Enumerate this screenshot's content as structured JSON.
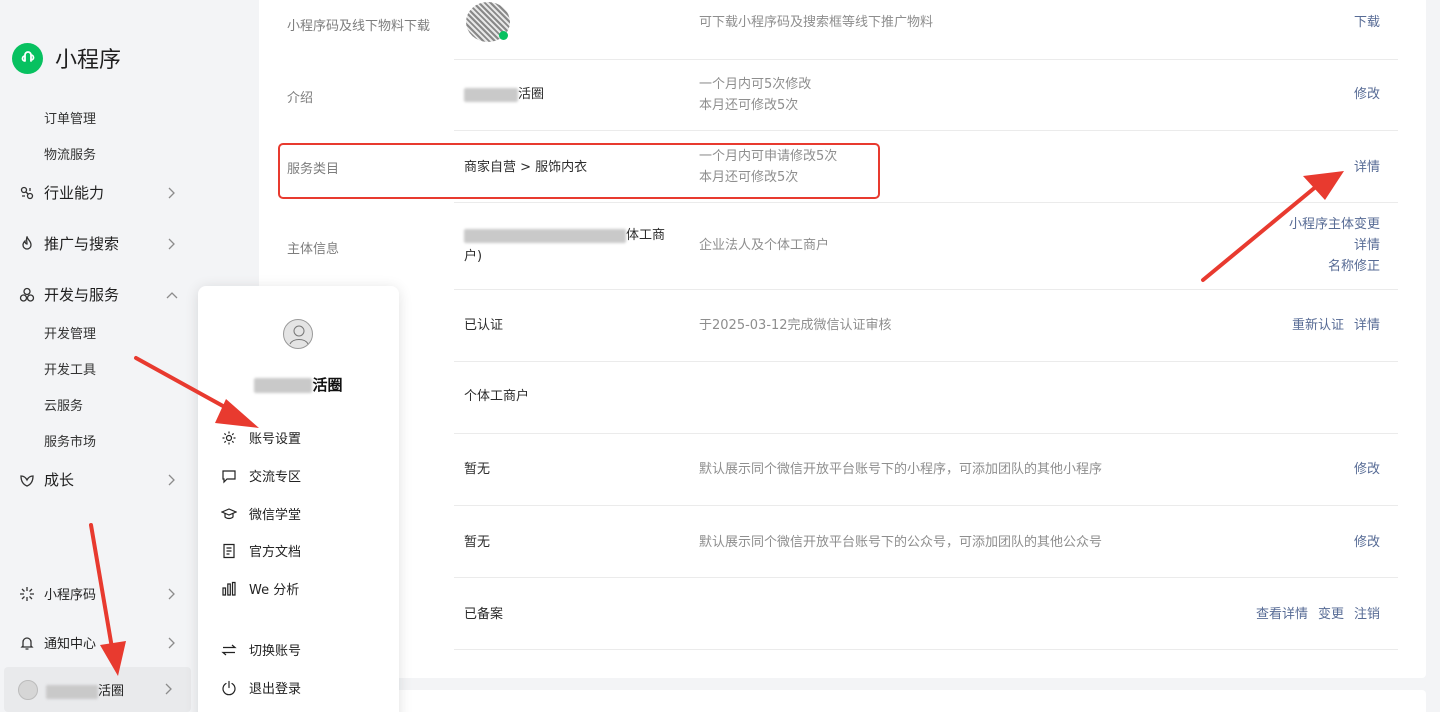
{
  "sidebar": {
    "title": "小程序",
    "items": {
      "order_mgmt": "订单管理",
      "logistics": "物流服务",
      "industry": "行业能力",
      "promo": "推广与搜索",
      "dev_service": "开发与服务",
      "dev_mgmt": "开发管理",
      "dev_tools": "开发工具",
      "cloud": "云服务",
      "market": "服务市场",
      "growth": "成长",
      "code": "小程序码",
      "notify": "通知中心"
    },
    "account_suffix": "活圈"
  },
  "rows": {
    "qrcode": {
      "label": "小程序码及线下物料下载",
      "desc": "可下载小程序码及搜索框等线下推广物料",
      "action": "下载"
    },
    "intro": {
      "label": "介绍",
      "value_suffix": "活圈",
      "desc1": "一个月内可5次修改",
      "desc2": "本月还可修改5次",
      "action": "修改"
    },
    "category": {
      "label": "服务类目",
      "value": "商家自营 > 服饰内衣",
      "desc1": "一个月内可申请修改5次",
      "desc2": "本月还可修改5次",
      "action": "详情"
    },
    "subject": {
      "label": "主体信息",
      "value_part": "体工商",
      "value_end": "户)",
      "desc": "企业法人及个体工商户",
      "action1": "小程序主体变更",
      "action2": "详情",
      "action3": "名称修正"
    },
    "certify": {
      "value": "已认证",
      "desc": "于2025-03-12完成微信认证审核",
      "action1": "重新认证",
      "action2": "详情"
    },
    "type": {
      "value": "个体工商户"
    },
    "related_mp": {
      "value": "暂无",
      "desc": "默认展示同个微信开放平台账号下的小程序，可添加团队的其他小程序",
      "action": "修改"
    },
    "related_oa": {
      "value": "暂无",
      "desc": "默认展示同个微信开放平台账号下的公众号，可添加团队的其他公众号",
      "action": "修改"
    },
    "filing": {
      "value": "已备案",
      "action1": "查看详情",
      "action2": "变更",
      "action3": "注销"
    }
  },
  "popup": {
    "name_suffix": "活圈",
    "items": {
      "account_settings": "账号设置",
      "community": "交流专区",
      "academy": "微信学堂",
      "docs": "官方文档",
      "we_analysis": "We 分析",
      "switch_account": "切换账号",
      "logout": "退出登录"
    }
  },
  "colors": {
    "accent": "#07c160",
    "link": "#576b95",
    "highlight": "#e83a2f"
  }
}
